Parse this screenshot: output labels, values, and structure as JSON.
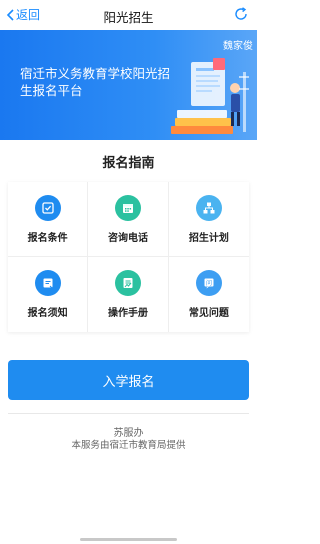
{
  "navbar": {
    "back_label": "返回",
    "title": "阳光招生"
  },
  "banner": {
    "title": "宿迁市义务教育学校阳光招生报名平台",
    "user_name": "魏家俊"
  },
  "guide": {
    "title": "报名指南",
    "items": [
      {
        "label": "报名条件",
        "icon": "checkbox-icon"
      },
      {
        "label": "咨询电话",
        "icon": "calendar-icon"
      },
      {
        "label": "招生计划",
        "icon": "org-chart-icon"
      },
      {
        "label": "报名须知",
        "icon": "note-icon"
      },
      {
        "label": "操作手册",
        "icon": "manual-icon"
      },
      {
        "label": "常见问题",
        "icon": "question-icon"
      }
    ]
  },
  "enroll_button": {
    "label": "入学报名"
  },
  "footer": {
    "brand": "苏服办",
    "note": "本服务由宿迁市教育局提供"
  },
  "colors": {
    "primary": "#1f8cf0",
    "teal": "#2bc1a0"
  }
}
